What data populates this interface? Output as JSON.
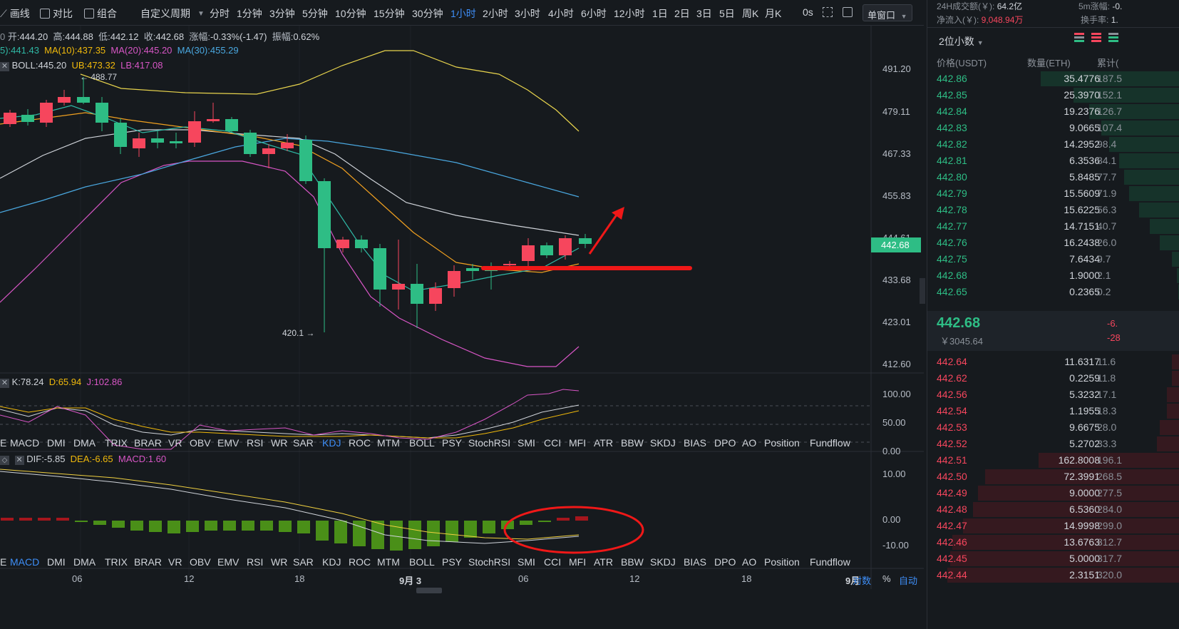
{
  "toolbar": {
    "draw_label": "画线",
    "compare_label": "对比",
    "combine_label": "组合",
    "custom_period_label": "自定义周期",
    "periods": [
      "分时",
      "1分钟",
      "3分钟",
      "5分钟",
      "10分钟",
      "15分钟",
      "30分钟",
      "1小时",
      "2小时",
      "3小时",
      "4小时",
      "6小时",
      "12小时",
      "1日",
      "2日",
      "3日",
      "5日",
      "周K",
      "月K"
    ],
    "active_period": "1小时",
    "zero_s": "0s",
    "window_select": "单窗口"
  },
  "ohlc": {
    "open_label": "开:",
    "open": "444.20",
    "high_label": "高:",
    "high": "444.88",
    "low_label": "低:",
    "low": "442.12",
    "close_label": "收:",
    "close": "442.68",
    "change_label": "涨幅:",
    "change": "-0.33%(-1.47)",
    "amplitude_label": "振幅:",
    "amplitude": "0.62%"
  },
  "ma": {
    "ma5": "5):441.43",
    "ma10": "MA(10):437.35",
    "ma20": "MA(20):445.20",
    "ma30": "MA(30):455.29"
  },
  "boll": {
    "boll": "BOLL:445.20",
    "ub": "UB:473.32",
    "lb": "LB:417.08"
  },
  "price_annotations": {
    "high": "← 488.77",
    "low": "420.1 →"
  },
  "price_axis": [
    "491.20",
    "479.11",
    "467.33",
    "455.83",
    "444.61",
    "433.68",
    "423.01",
    "412.60"
  ],
  "last_price_tag": "442.68",
  "kdj": {
    "k": "K:78.24",
    "d": "D:65.94",
    "j": "J:102.86",
    "axis": [
      "100.00",
      "50.00",
      "0.00"
    ]
  },
  "macd": {
    "dif": "DIF:-5.85",
    "dea": "DEA:-6.65",
    "macd": "MACD:1.60",
    "axis": [
      "10.00",
      "0.00",
      "-10.00"
    ]
  },
  "indicator_tabs_1": [
    "E",
    "MACD",
    "DMI",
    "DMA",
    "TRIX",
    "BRAR",
    "VR",
    "OBV",
    "EMV",
    "RSI",
    "WR",
    "SAR",
    "KDJ",
    "ROC",
    "MTM",
    "BOLL",
    "PSY",
    "StochRSI",
    "SMI",
    "CCI",
    "MFI",
    "ATR",
    "BBW",
    "SKDJ",
    "BIAS",
    "DPO",
    "AO",
    "Position",
    "Fundflow"
  ],
  "indicator_tabs_1_active": "KDJ",
  "indicator_tabs_2": [
    "E",
    "MACD",
    "DMI",
    "DMA",
    "TRIX",
    "BRAR",
    "VR",
    "OBV",
    "EMV",
    "RSI",
    "WR",
    "SAR",
    "KDJ",
    "ROC",
    "MTM",
    "BOLL",
    "PSY",
    "StochRSI",
    "SMI",
    "CCI",
    "MFI",
    "ATR",
    "BBW",
    "SKDJ",
    "BIAS",
    "DPO",
    "AO",
    "Position",
    "Fundflow"
  ],
  "indicator_tabs_2_active": "MACD",
  "time_axis": [
    "06",
    "12",
    "18",
    "9月 3",
    "06",
    "12",
    "18",
    "9月"
  ],
  "bottom_controls": {
    "log": "对数",
    "percent": "%",
    "auto": "自动"
  },
  "panel": {
    "volume_24h_label": "24H成交额(￥):",
    "volume_24h": "64.2亿",
    "net_inflow_label": "净流入(￥):",
    "net_inflow": "9,048.94万",
    "change_5m_label": "5m涨幅:",
    "change_5m": "-0.",
    "turnover_label": "换手率:",
    "turnover": "1.",
    "precision": "2位小数",
    "headers": {
      "price": "价格(USDT)",
      "qty": "数量(ETH)",
      "cum": "累计("
    },
    "mid_price": "442.68",
    "mid_cny": "￥3045.64",
    "mid_change": "-6.",
    "mid_change2": "-28",
    "asks_top": [
      {
        "p": "442.86",
        "q": "35.4776",
        "c": "187.5",
        "d": 0.55
      },
      {
        "p": "442.85",
        "q": "25.3970",
        "c": "152.1",
        "d": 0.42
      },
      {
        "p": "442.84",
        "q": "19.2376",
        "c": "126.7",
        "d": 0.36
      },
      {
        "p": "442.83",
        "q": "9.0665",
        "c": "107.4",
        "d": 0.31
      },
      {
        "p": "442.82",
        "q": "14.2952",
        "c": "98.4",
        "d": 0.28
      },
      {
        "p": "442.81",
        "q": "6.3536",
        "c": "84.1",
        "d": 0.24
      },
      {
        "p": "442.80",
        "q": "5.8485",
        "c": "77.7",
        "d": 0.22
      },
      {
        "p": "442.79",
        "q": "15.5609",
        "c": "71.9",
        "d": 0.2
      },
      {
        "p": "442.78",
        "q": "15.6225",
        "c": "56.3",
        "d": 0.16
      },
      {
        "p": "442.77",
        "q": "14.7151",
        "c": "40.7",
        "d": 0.12
      },
      {
        "p": "442.76",
        "q": "16.2438",
        "c": "26.0",
        "d": 0.08
      },
      {
        "p": "442.75",
        "q": "7.6434",
        "c": "9.7",
        "d": 0.03
      },
      {
        "p": "442.68",
        "q": "1.9000",
        "c": "2.1",
        "d": 0.01
      },
      {
        "p": "442.65",
        "q": "0.2365",
        "c": "0.2",
        "d": 0.005
      }
    ],
    "bids": [
      {
        "p": "442.64",
        "q": "11.6317",
        "c": "11.6",
        "d": 0.03
      },
      {
        "p": "442.62",
        "q": "0.2259",
        "c": "11.8",
        "d": 0.03
      },
      {
        "p": "442.56",
        "q": "5.3232",
        "c": "17.1",
        "d": 0.05
      },
      {
        "p": "442.54",
        "q": "1.1955",
        "c": "18.3",
        "d": 0.05
      },
      {
        "p": "442.53",
        "q": "9.6675",
        "c": "28.0",
        "d": 0.08
      },
      {
        "p": "442.52",
        "q": "5.2702",
        "c": "33.3",
        "d": 0.09
      },
      {
        "p": "442.51",
        "q": "162.8008",
        "c": "196.1",
        "d": 0.56
      },
      {
        "p": "442.50",
        "q": "72.3991",
        "c": "268.5",
        "d": 0.77
      },
      {
        "p": "442.49",
        "q": "9.0000",
        "c": "277.5",
        "d": 0.8
      },
      {
        "p": "442.48",
        "q": "6.5360",
        "c": "284.0",
        "d": 0.82
      },
      {
        "p": "442.47",
        "q": "14.9998",
        "c": "299.0",
        "d": 0.86
      },
      {
        "p": "442.46",
        "q": "13.6763",
        "c": "312.7",
        "d": 0.9
      },
      {
        "p": "442.45",
        "q": "5.0000",
        "c": "317.7",
        "d": 0.91
      },
      {
        "p": "442.44",
        "q": "2.3151",
        "c": "320.0",
        "d": 0.92
      }
    ]
  },
  "colors": {
    "up": "#2ebd85",
    "down": "#f6465d",
    "accent": "#3e8ef7"
  }
}
